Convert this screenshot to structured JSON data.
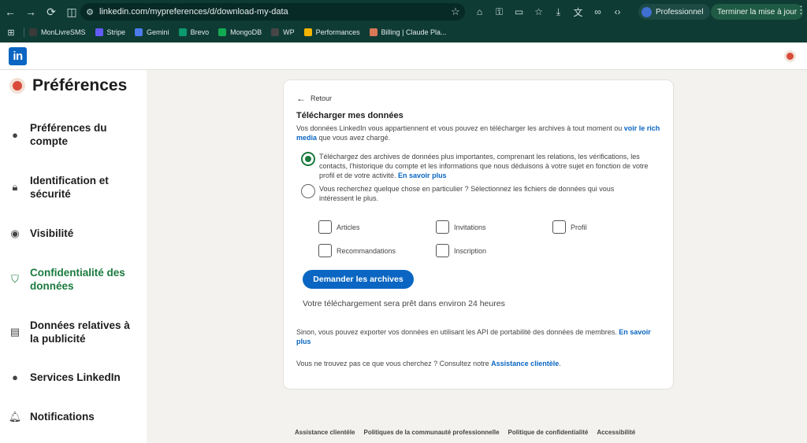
{
  "browser": {
    "url": "linkedin.com/mypreferences/d/download-my-data",
    "profile_label": "Professionnel",
    "update_label": "Terminer la mise à jour",
    "bookmarks": [
      {
        "label": "MonLivreSMS",
        "color": "#3a3a3a"
      },
      {
        "label": "Stripe",
        "color": "#635bff"
      },
      {
        "label": "Gemini",
        "color": "#4b7bec"
      },
      {
        "label": "Brevo",
        "color": "#0b996e"
      },
      {
        "label": "MongoDB",
        "color": "#13aa52"
      },
      {
        "label": "WP",
        "color": "#464646"
      },
      {
        "label": "Performances",
        "color": "#f4b400"
      },
      {
        "label": "Billing | Claude Pla...",
        "color": "#d97757"
      }
    ]
  },
  "linkedin": {
    "logo_text": "in"
  },
  "sidebar": {
    "title": "Préférences",
    "items": [
      {
        "label": "Préférences du compte",
        "icon": "person-icon"
      },
      {
        "label": "Identification et sécurité",
        "icon": "lock-icon"
      },
      {
        "label": "Visibilité",
        "icon": "eye-icon"
      },
      {
        "label": "Confidentialité des données",
        "icon": "shield-icon",
        "active": true
      },
      {
        "label": "Données relatives à la publicité",
        "icon": "newspaper-icon"
      },
      {
        "label": "Services LinkedIn",
        "icon": "person-icon"
      },
      {
        "label": "Notifications",
        "icon": "bell-icon"
      }
    ]
  },
  "card": {
    "back_label": "Retour",
    "title": "Télécharger mes données",
    "desc_text": "Vos données LinkedIn vous appartiennent et vous pouvez en télécharger les archives à tout moment ou ",
    "desc_link": "voir le rich media",
    "desc_after": " que vous avez chargé.",
    "option1_text": "Téléchargez des archives de données plus importantes, comprenant les relations, les vérifications, les contacts, l'historique du compte et les informations que nous déduisons à votre sujet en fonction de votre profil et de votre activité. ",
    "option1_link": "En savoir plus",
    "option2_text": "Vous recherchez quelque chose en particulier ? Sélectionnez les fichiers de données qui vous intéressent le plus.",
    "checkboxes": [
      "Articles",
      "Invitations",
      "Profil",
      "Recommandations",
      "Inscription"
    ],
    "cta_label": "Demander les archives",
    "ready_text": "Votre téléchargement sera prêt dans environ 24 heures",
    "alt_text": "Sinon, vous pouvez exporter vos données en utilisant les API de portabilité des données de membres. ",
    "alt_link": "En savoir plus",
    "help_text": "Vous ne trouvez pas ce que vous cherchez ? Consultez notre ",
    "help_link": "Assistance clientèle",
    "help_after": "."
  },
  "footer": {
    "links": [
      "Assistance clientèle",
      "Politiques de la communauté professionnelle",
      "Politique de confidentialité",
      "Accessibilité"
    ]
  },
  "colors": {
    "accent_green": "#1a7a3e",
    "linkedin_blue": "#0a66c2",
    "chrome_bg": "#0f3b35"
  }
}
